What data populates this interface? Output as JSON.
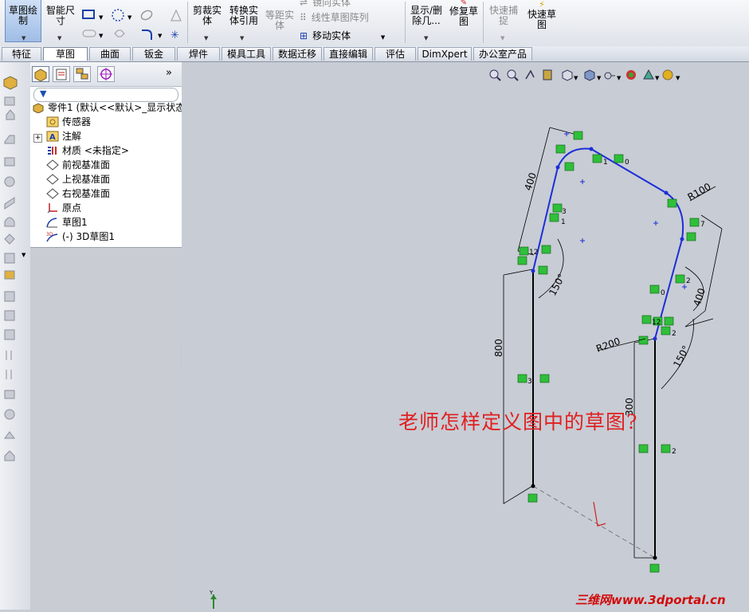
{
  "ribbon": {
    "sketch_label": "草图绘\n制",
    "smart_dim_label": "智能尺\n寸",
    "trim_label": "剪裁实\n体",
    "convert_label": "转换实\n体引用",
    "offset_label": "等距实\n体",
    "mirror_label": "镜向实体",
    "linear_pattern_label": "线性草图阵列",
    "move_label": "移动实体",
    "show_delete_label": "显示/删\n除几...",
    "repair_label": "修复草\n图",
    "quick_snap_label": "快速捕\n捉",
    "rapid_sketch_label": "快速草\n图"
  },
  "tabs": [
    "特征",
    "草图",
    "曲面",
    "钣金",
    "焊件",
    "模具工具",
    "数据迁移",
    "直接编辑",
    "评估",
    "DimXpert",
    "办公室产品"
  ],
  "active_tab": "草图",
  "feature_tree": {
    "collapse_label": "»",
    "root": "零件1 (默认<<默认>_显示状态",
    "items": [
      {
        "label": "传感器",
        "icon": "sensor-icon"
      },
      {
        "label": "注解",
        "icon": "annotation-icon",
        "expand": "+"
      },
      {
        "label": "材质 <未指定>",
        "icon": "material-icon"
      },
      {
        "label": "前视基准面",
        "icon": "plane-icon"
      },
      {
        "label": "上视基准面",
        "icon": "plane-icon"
      },
      {
        "label": "右视基准面",
        "icon": "plane-icon"
      },
      {
        "label": "原点",
        "icon": "origin-icon"
      },
      {
        "label": "草图1",
        "icon": "sketch-icon"
      },
      {
        "label": "(-) 3D草图1",
        "icon": "3d-sketch-icon"
      }
    ]
  },
  "drawing": {
    "dims": {
      "d400_top": "400",
      "d400_right": "400",
      "r100": "R100",
      "r200": "R200",
      "a150_left": "150°",
      "a150_right": "150°",
      "d800": "800",
      "d300": "300"
    },
    "relations": {
      "n3": "3",
      "n1": "1",
      "n0": "0",
      "n12": "12",
      "n7": "7",
      "n2": "2"
    },
    "axis_label": "Y"
  },
  "overlay": {
    "question": "老师怎样定义图中的草图?",
    "watermark": "三维网www.3dportal.cn"
  },
  "colors": {
    "sketch_blue": "#1c2fd8",
    "relation_green": "#2fbf3a",
    "question_red": "#e02020"
  }
}
